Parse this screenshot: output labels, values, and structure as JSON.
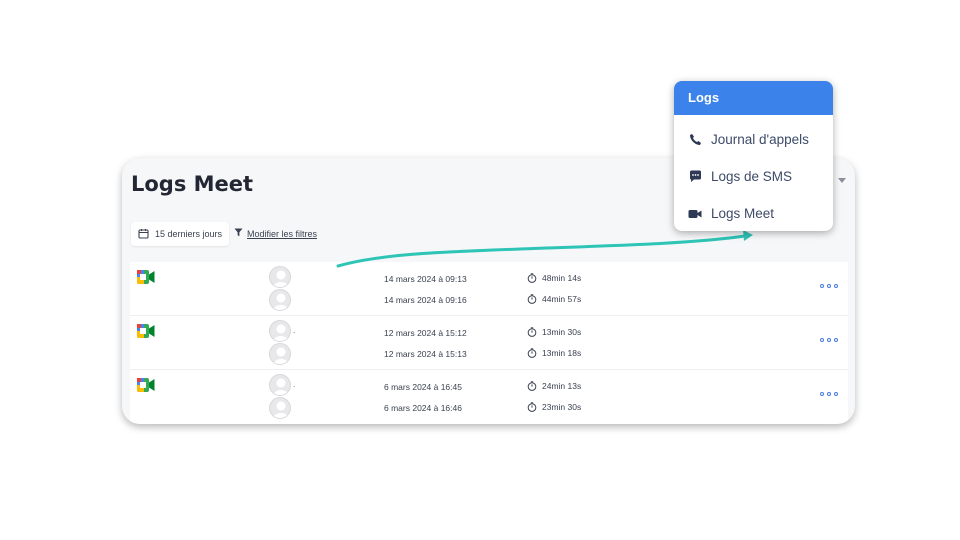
{
  "page": {
    "title": "Logs Meet",
    "filters": {
      "period_label": "15 derniers jours",
      "modify_label": "Modifier les filtres"
    }
  },
  "meet_logs": [
    {
      "entries": [
        {
          "date": "14 mars 2024 à 09:13",
          "duration": "48min 14s"
        },
        {
          "date": "14 mars 2024 à 09:16",
          "duration": "44min 57s"
        }
      ]
    },
    {
      "entries": [
        {
          "date": "12 mars 2024 à 15:12",
          "duration": "13min 30s"
        },
        {
          "date": "12 mars 2024 à 15:13",
          "duration": "13min 18s"
        }
      ]
    },
    {
      "entries": [
        {
          "date": "6 mars 2024 à 16:45",
          "duration": "24min 13s"
        },
        {
          "date": "6 mars 2024 à 16:46",
          "duration": "23min 30s"
        }
      ]
    }
  ],
  "dropdown": {
    "header": "Logs",
    "items": [
      {
        "label": "Journal d'appels",
        "icon": "phone-icon"
      },
      {
        "label": "Logs de SMS",
        "icon": "message-icon"
      },
      {
        "label": "Logs Meet",
        "icon": "video-icon"
      }
    ]
  },
  "colors": {
    "accent": "#3b82ea",
    "arrow": "#2ec4b6",
    "text": "#3d4b68"
  }
}
